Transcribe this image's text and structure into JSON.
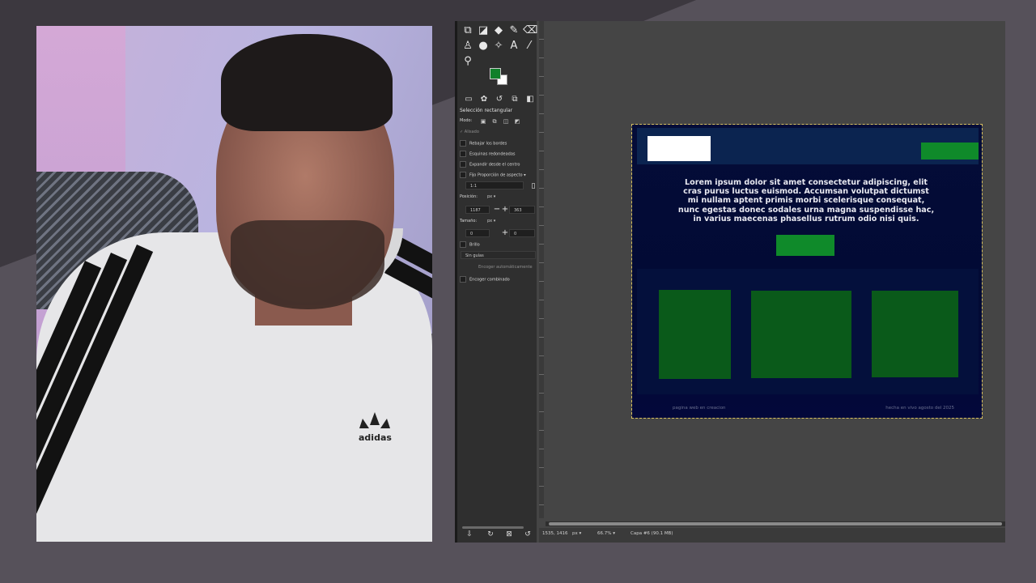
{
  "webcam": {
    "brand_text": "adidas"
  },
  "gimp": {
    "tool_options": {
      "title": "Selección rectangular",
      "mode_label": "Modo:",
      "antialias": "Alisado",
      "feather": "Rebajar los bordes",
      "rounded": "Esquinas redondeadas",
      "expand_center": "Expandir desde el centro",
      "fixed": "Fijo",
      "fixed_value": "Proporción de aspecto",
      "ratio": "1:1",
      "position_label": "Posición:",
      "position_unit": "px",
      "position_x": "1187",
      "position_y": "363",
      "size_label": "Tamaño:",
      "size_unit": "px",
      "size_w": "0",
      "size_h": "0",
      "highlight": "Brillo",
      "guides": "Sin guías",
      "autoshrink": "Encoger automáticamente",
      "shrink_merged": "Encoger combinado"
    },
    "status": {
      "coords": "1535, 1416",
      "unit": "px",
      "zoom": "66.7%",
      "layer": "Capa #6 (90.1 MB)"
    },
    "colors": {
      "foreground": "#10802a",
      "background": "#ffffff"
    }
  },
  "canvas_image": {
    "hero_text": "Lorem ipsum dolor sit amet consectetur adipiscing, elit cras purus luctus euismod. Accumsan volutpat dictumst mi nullam aptent primis morbi scelerisque consequat, nunc egestas donec sodales urna magna suspendisse hac, in varius maecenas phasellus rutrum odio nisi quis.",
    "footer_left": "pagina web en creacion",
    "footer_right": "hecha en vivo agosto del 2025",
    "accent_color": "#0f8a2a",
    "header_color": "#0b2450"
  }
}
